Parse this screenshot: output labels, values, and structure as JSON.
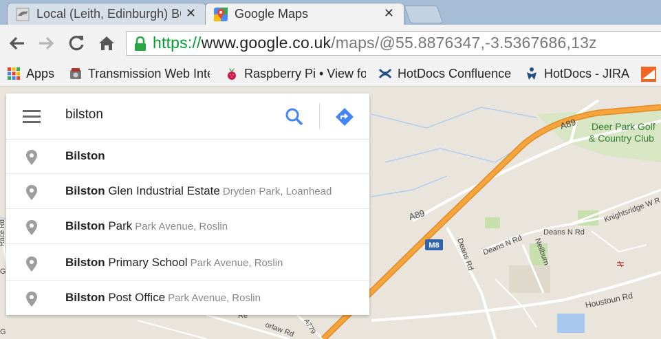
{
  "browser": {
    "tabs": [
      {
        "title": "Local (Leith, Edinburgh) BC",
        "close": "✕",
        "active": false,
        "icon": "local-favicon"
      },
      {
        "title": "Google Maps",
        "close": "✕",
        "active": true,
        "icon": "google-maps-favicon"
      }
    ],
    "url": {
      "scheme": "https://",
      "host": "www.google.co.uk",
      "path": "/maps/@55.8876347,-3.5367686,13z"
    },
    "bookmarks": [
      {
        "label": "Apps",
        "icon": "apps-grid-icon"
      },
      {
        "label": "Transmission Web Inte",
        "icon": "transmission-icon"
      },
      {
        "label": "Raspberry Pi • View fo",
        "icon": "raspberry-pi-icon"
      },
      {
        "label": "HotDocs Confluence",
        "icon": "confluence-icon"
      },
      {
        "label": "HotDocs - JIRA",
        "icon": "jira-icon"
      }
    ]
  },
  "search": {
    "query": "bilston",
    "suggestions": [
      {
        "bold": "Bilston",
        "rest": "",
        "sub": ""
      },
      {
        "bold": "Bilston",
        "rest": " Glen Industrial Estate",
        "sub": "Dryden Park, Loanhead"
      },
      {
        "bold": "Bilston",
        "rest": " Park",
        "sub": "Park Avenue, Roslin"
      },
      {
        "bold": "Bilston",
        "rest": " Primary School",
        "sub": "Park Avenue, Roslin"
      },
      {
        "bold": "Bilston",
        "rest": " Post Office",
        "sub": "Park Avenue, Roslin"
      }
    ]
  },
  "map": {
    "labels": {
      "a89_top": "A89",
      "a89_mid": "A89",
      "m8": "M8",
      "deer_park_1": "Deer Park Golf",
      "deer_park_2": "& Country Club",
      "knightsridge": "Knightsridge W R",
      "deans_n_rd_1": "Deans N Rd",
      "deans_n_rd_2": "Deans N Rd",
      "deans_rd": "Deans Rd",
      "nellburn": "Nellburn",
      "houstoun_rd": "Houstoun Rd",
      "race_rd": "Race Rd",
      "orlaw_rd": "orlaw Rd",
      "a779": "A779",
      "re_cut": "Re",
      "g_cut1": "G",
      "g_cut2": "G"
    },
    "colors": {
      "motorway": "#f6a53c",
      "motorway_edge": "#e08a24",
      "land": "#e9e5dc",
      "park": "#c8dfae",
      "water": "#a8c8f0",
      "road": "#ffffff",
      "m8_shield": "#3363a8"
    }
  }
}
